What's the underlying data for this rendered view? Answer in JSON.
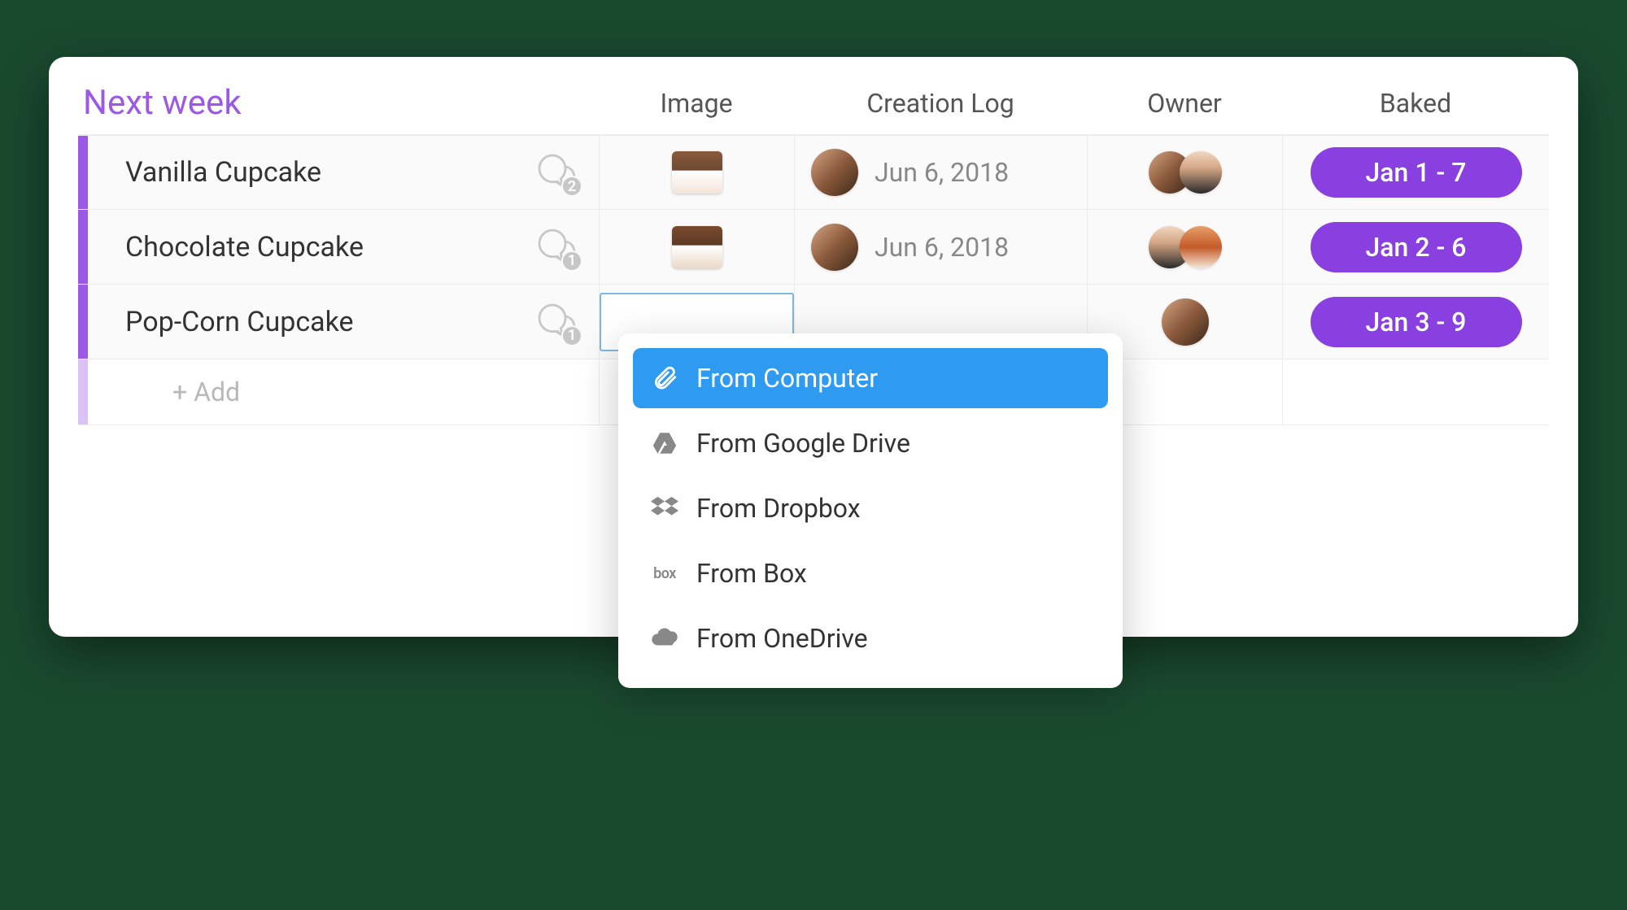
{
  "group_title": "Next week",
  "columns": {
    "image": "Image",
    "creation_log": "Creation Log",
    "owner": "Owner",
    "baked": "Baked"
  },
  "rows": [
    {
      "name": "Vanilla Cupcake",
      "comments": "2",
      "creation_date": "Jun 6, 2018",
      "baked": "Jan 1 - 7"
    },
    {
      "name": "Chocolate Cupcake",
      "comments": "1",
      "creation_date": "Jun 6, 2018",
      "baked": "Jan 2 - 6"
    },
    {
      "name": "Pop-Corn Cupcake",
      "comments": "1",
      "creation_date": "",
      "baked": "Jan 3 - 9"
    }
  ],
  "add_row_label": "+ Add",
  "upload_menu": {
    "items": [
      {
        "label": "From Computer",
        "icon": "paperclip-icon",
        "selected": true
      },
      {
        "label": "From Google Drive",
        "icon": "gdrive-icon",
        "selected": false
      },
      {
        "label": "From Dropbox",
        "icon": "dropbox-icon",
        "selected": false
      },
      {
        "label": "From Box",
        "icon": "box-icon",
        "selected": false
      },
      {
        "label": "From OneDrive",
        "icon": "onedrive-icon",
        "selected": false
      }
    ]
  },
  "colors": {
    "accent": "#9b59e6",
    "baked_pill": "#8a3fe0",
    "menu_selected": "#2e9bf0"
  }
}
